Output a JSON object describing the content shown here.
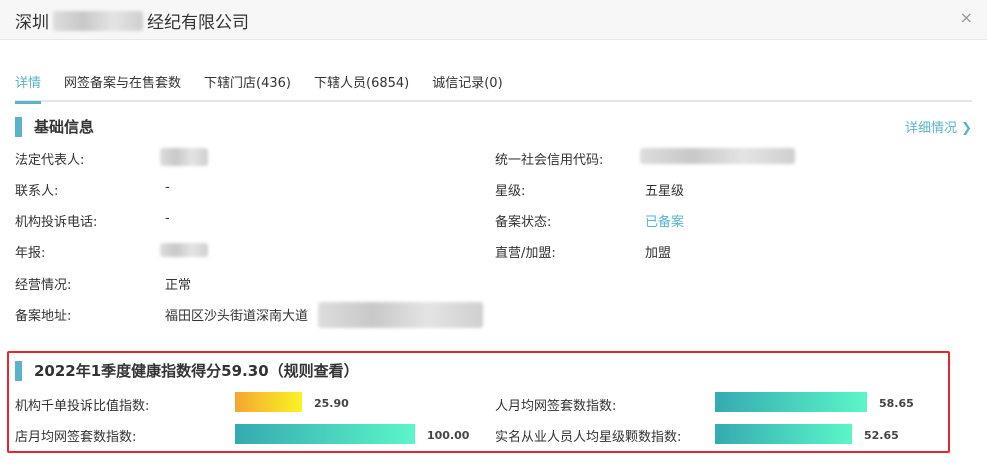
{
  "header": {
    "title_prefix": "深圳",
    "title_suffix": "经纪有限公司",
    "close": "×"
  },
  "tabs": [
    {
      "label": "详情",
      "active": true
    },
    {
      "label": "网签备案与在售套数"
    },
    {
      "label": "下辖门店(436)"
    },
    {
      "label": "下辖人员(6854)"
    },
    {
      "label": "诚信记录(0)"
    }
  ],
  "basic": {
    "title": "基础信息",
    "more": "详细情况 ❯",
    "left": [
      {
        "label": "法定代表人:",
        "value": null
      },
      {
        "label": "联系人:",
        "value": "-"
      },
      {
        "label": "机构投诉电话:",
        "value": "-"
      },
      {
        "label": "年报:",
        "value": null
      },
      {
        "label": "经营情况:",
        "value": "正常"
      },
      {
        "label": "备案地址:",
        "value": "福田区沙头街道深南大道"
      }
    ],
    "right": [
      {
        "label": "统一社会信用代码:",
        "value": null
      },
      {
        "label": "星级:",
        "value": "五星级"
      },
      {
        "label": "备案状态:",
        "value": "已备案"
      },
      {
        "label": "直营/加盟:",
        "value": "加盟"
      }
    ]
  },
  "health": {
    "title": "2022年1季度健康指数得分59.30（规则查看）",
    "items": [
      {
        "label": "机构千单投诉比值指数:",
        "value": "25.90",
        "num": 25.9,
        "style": "warn"
      },
      {
        "label": "人月均网签套数指数:",
        "value": "58.65",
        "num": 58.65
      },
      {
        "label": "店月均网签套数指数:",
        "value": "100.00",
        "num": 100
      },
      {
        "label": "实名从业人员人均星级颗数指数:",
        "value": "52.65",
        "num": 52.65
      }
    ]
  },
  "colors": {
    "accent": "#5ab3c9",
    "highlight": "#e5262b"
  }
}
